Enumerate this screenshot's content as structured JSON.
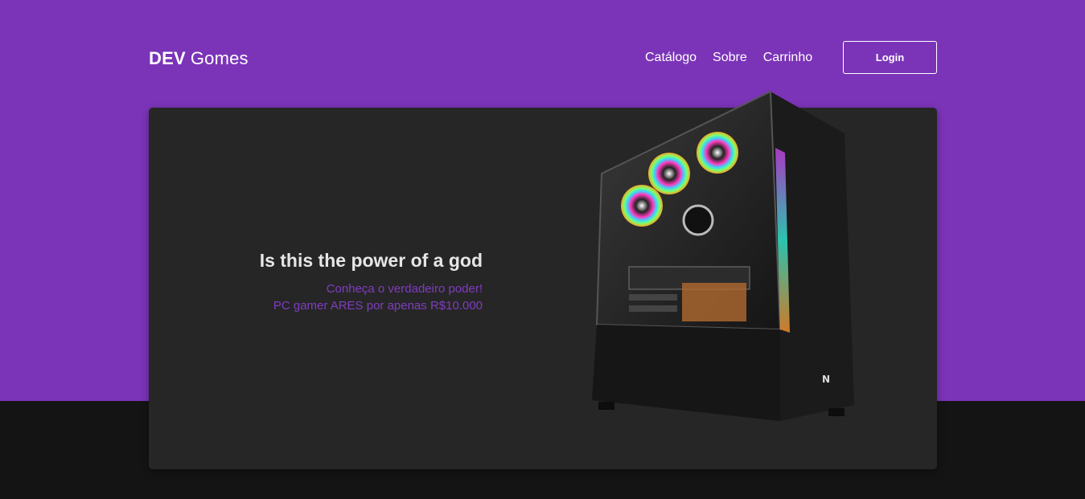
{
  "header": {
    "logo_strong": "DEV",
    "logo_light": "Gomes",
    "nav": [
      "Catálogo",
      "Sobre",
      "Carrinho"
    ],
    "login_label": "Login"
  },
  "hero": {
    "title": "Is this the power of a god",
    "subtitle_line1": "Conheça o verdadeiro poder!",
    "subtitle_line2": "PC gamer ARES por apenas R$10.000",
    "product_image": "gaming-pc-case-image"
  },
  "colors": {
    "brand_purple": "#7b34b8",
    "accent_purple_text": "#7f3cc0",
    "card_bg": "#262626",
    "page_dark": "#141414"
  }
}
